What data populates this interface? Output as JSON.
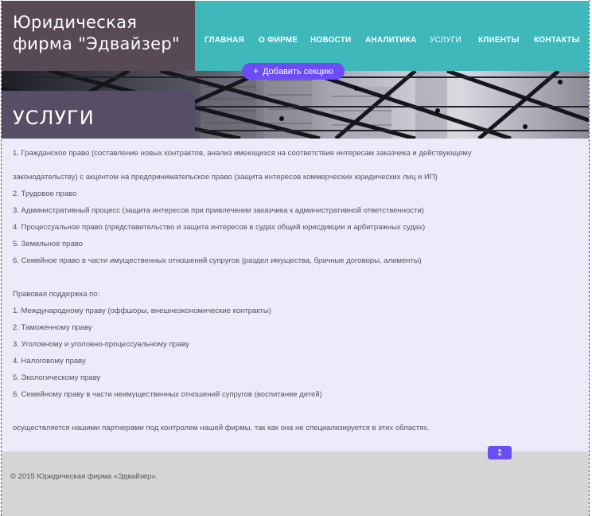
{
  "header": {
    "brand_line1": "Юридическая",
    "brand_line2": "фирма \"Эдвайзер\"",
    "nav": [
      {
        "label": "ГЛАВНАЯ"
      },
      {
        "label": "О ФИРМЕ"
      },
      {
        "label": "НОВОСТИ"
      },
      {
        "label": "АНАЛИТИКА"
      },
      {
        "label": "УСЛУГИ"
      },
      {
        "label": "КЛИЕНТЫ"
      },
      {
        "label": "КОНТАКТЫ"
      }
    ],
    "active_nav": "УСЛУГИ"
  },
  "editor": {
    "add_section_label": "Добавить секцию",
    "add_section_icon": "plus-icon",
    "resize_icon": "vertical-resize-icon"
  },
  "banner": {
    "title": "УСЛУГИ"
  },
  "content": {
    "lines": [
      "1. Гражданское право (составление новых контрактов, анализ имеющихся на соответствие интересам заказчика и действующему",
      "законодательству) с акцентом на предпринимательское право (защита интересов коммерческих юридических лиц и ИП)",
      "2. Трудовое право",
      "3. Административный процесс (защита интересов при привлечении заказчика к административной ответственности)",
      "4. Процессуальное право (представительство и защита интересов в судах общей юрисдикции и арбитражных судах)",
      "5. Земельное право",
      "6. Семейное право в части имущественных отношений супругов (раздел имущества, брачные договоры, алименты)",
      "Правовая поддержка по:",
      "1. Международному праву (оффшоры, внешнеэкономические контракты)",
      "2. Таможенному праву",
      "3. Уголовному и уголовно-процессуальному праву",
      "4. Налоговому праву",
      "5. Экологическому праву",
      "6. Семейному праву в части неимущественных отношений супругов (воспитание детей)",
      "осуществляется нашими партнерами под контролем нашей фирмы, так как она не специализируется в этих областях."
    ]
  },
  "footer": {
    "copyright": "© 2015  Юридическая фирма «Эдвайзер»."
  },
  "colors": {
    "brand_bg": "#584a55",
    "nav_bg": "#3fb8bb",
    "title_box_bg": "#574d64",
    "content_bg": "#eeeaf9",
    "footer_bg": "#d6d6d6",
    "editor_accent": "#6a4df5"
  }
}
